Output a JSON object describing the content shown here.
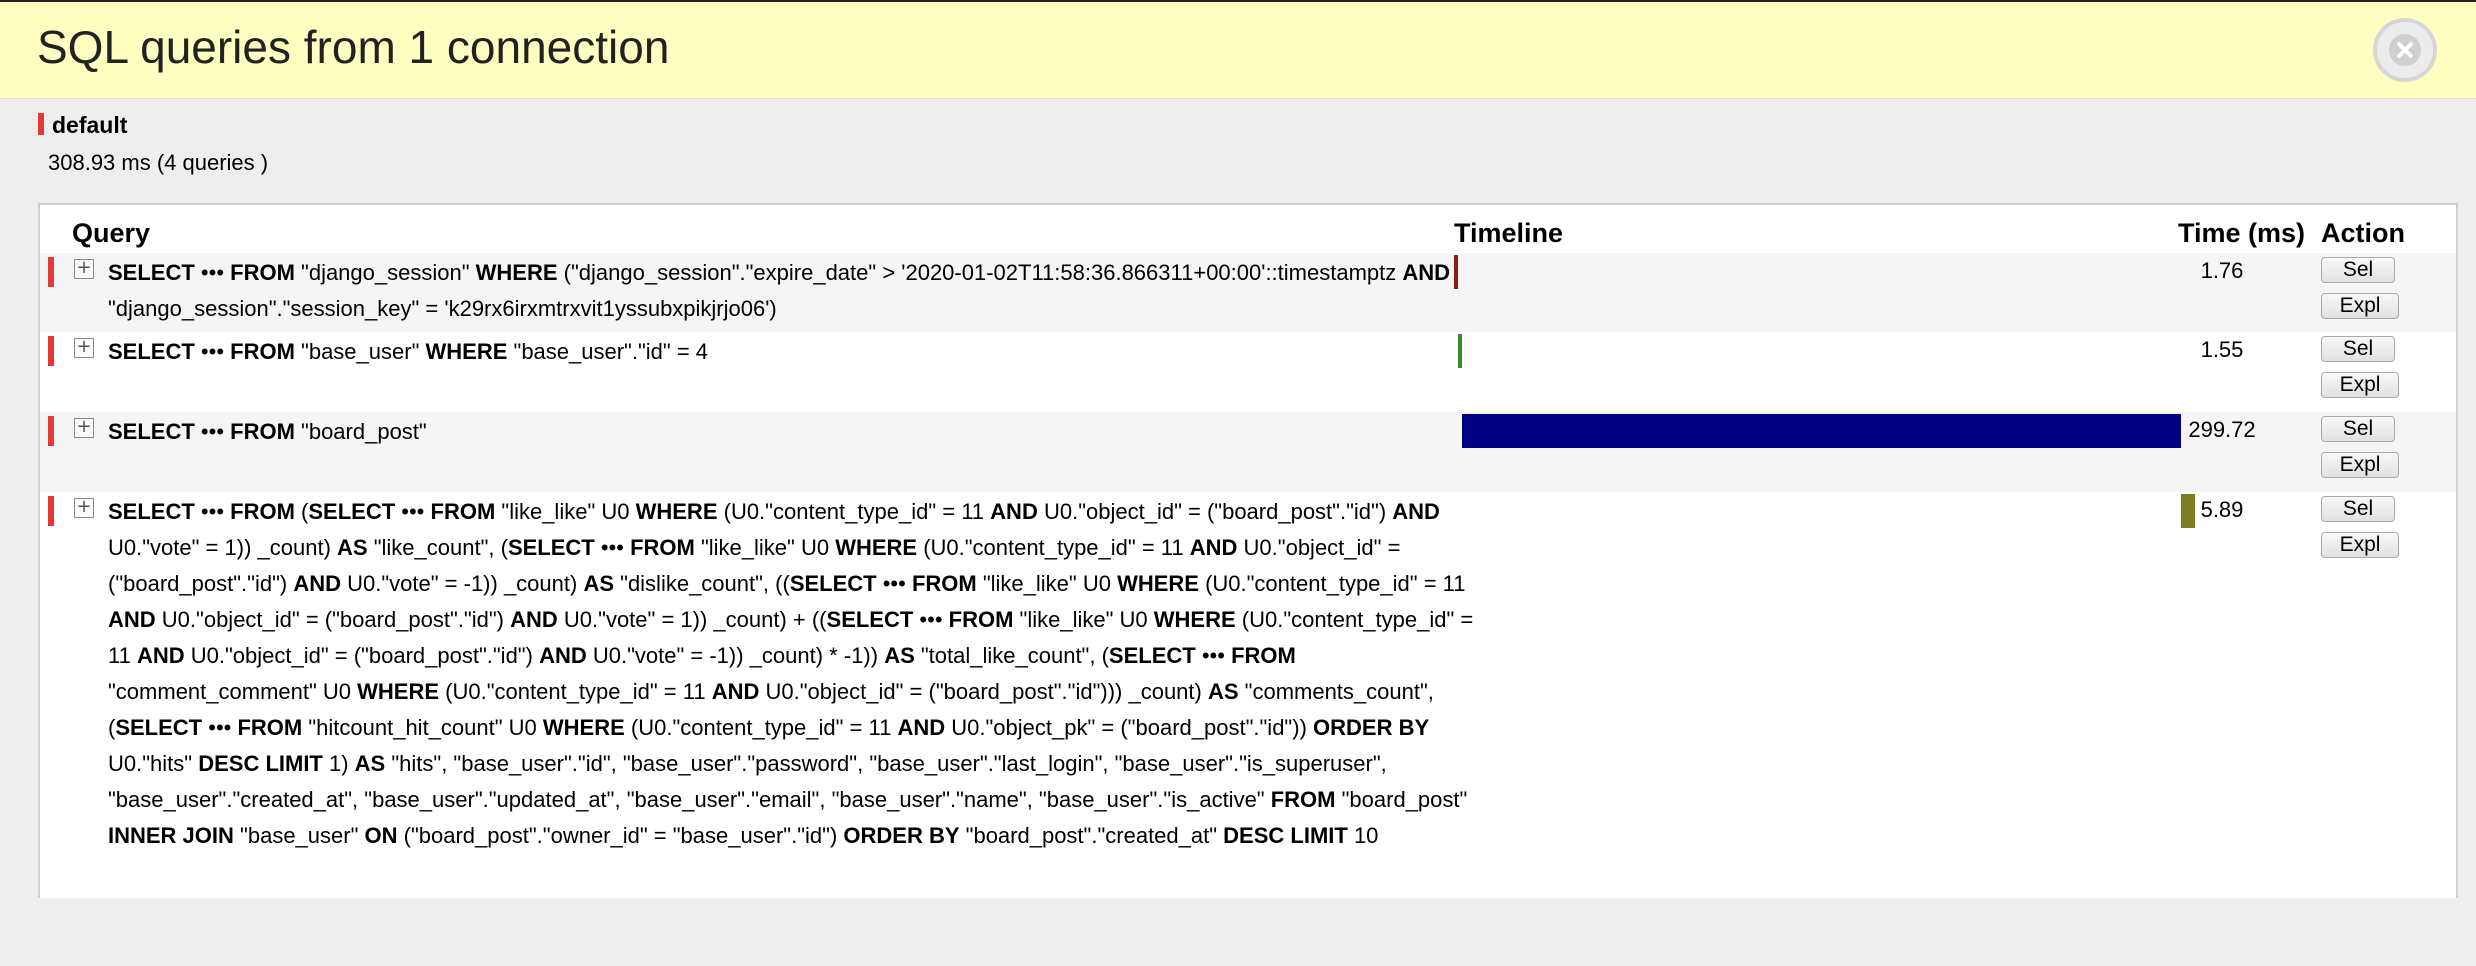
{
  "header": {
    "title": "SQL queries from 1 connection",
    "close_icon": "close-icon"
  },
  "connection": {
    "name": "default",
    "stats": "308.93 ms (4 queries )",
    "marker_color": "#e53935"
  },
  "table": {
    "columns": {
      "query": "Query",
      "timeline": "Timeline",
      "time": "Time (ms)",
      "action": "Action"
    },
    "toggle_label": "+",
    "sel_label": "Sel",
    "expl_label": "Expl",
    "rows": [
      {
        "sql": "SELECT ••• FROM \"django_session\" WHERE (\"django_session\".\"expire_date\" > '2020-01-02T11:58:36.866311+00:00'::timestamptz AND \"django_session\".\"session_key\" = 'k29rx6irxmtrxvit1yssubxpikjrjo06')",
        "time_ms": "1.76",
        "timeline_start_pct": 0.0,
        "timeline_width_pct": 0.56,
        "bar_color": "#8b1a1a"
      },
      {
        "sql": "SELECT ••• FROM \"base_user\" WHERE \"base_user\".\"id\" = 4",
        "time_ms": "1.55",
        "timeline_start_pct": 0.57,
        "timeline_width_pct": 0.5,
        "bar_color": "#3a8a2a"
      },
      {
        "sql": "SELECT ••• FROM \"board_post\"",
        "time_ms": "299.72",
        "timeline_start_pct": 1.07,
        "timeline_width_pct": 97.02,
        "bar_color": "#000080"
      },
      {
        "sql": "SELECT ••• FROM (SELECT ••• FROM \"like_like\" U0 WHERE (U0.\"content_type_id\" = 11 AND U0.\"object_id\" = (\"board_post\".\"id\") AND U0.\"vote\" = 1)) _count) AS \"like_count\", (SELECT ••• FROM \"like_like\" U0 WHERE (U0.\"content_type_id\" = 11 AND U0.\"object_id\" = (\"board_post\".\"id\") AND U0.\"vote\" = -1)) _count) AS \"dislike_count\", ((SELECT ••• FROM \"like_like\" U0 WHERE (U0.\"content_type_id\" = 11 AND U0.\"object_id\" = (\"board_post\".\"id\") AND U0.\"vote\" = 1)) _count) + ((SELECT ••• FROM \"like_like\" U0 WHERE (U0.\"content_type_id\" = 11 AND U0.\"object_id\" = (\"board_post\".\"id\") AND U0.\"vote\" = -1)) _count) * -1)) AS \"total_like_count\", (SELECT ••• FROM \"comment_comment\" U0 WHERE (U0.\"content_type_id\" = 11 AND U0.\"object_id\" = (\"board_post\".\"id\"))) _count) AS \"comments_count\", (SELECT ••• FROM \"hitcount_hit_count\" U0 WHERE (U0.\"content_type_id\" = 11 AND U0.\"object_pk\" = (\"board_post\".\"id\")) ORDER BY U0.\"hits\" DESC LIMIT 1) AS \"hits\", \"base_user\".\"id\", \"base_user\".\"password\", \"base_user\".\"last_login\", \"base_user\".\"is_superuser\", \"base_user\".\"created_at\", \"base_user\".\"updated_at\", \"base_user\".\"email\", \"base_user\".\"name\", \"base_user\".\"is_active\" FROM \"board_post\" INNER JOIN \"base_user\" ON (\"board_post\".\"owner_id\" = \"base_user\".\"id\") ORDER BY \"board_post\".\"created_at\" DESC LIMIT 10",
        "time_ms": "5.89",
        "timeline_start_pct": 98.1,
        "timeline_width_pct": 1.9,
        "bar_color": "#7c7c25"
      }
    ]
  }
}
